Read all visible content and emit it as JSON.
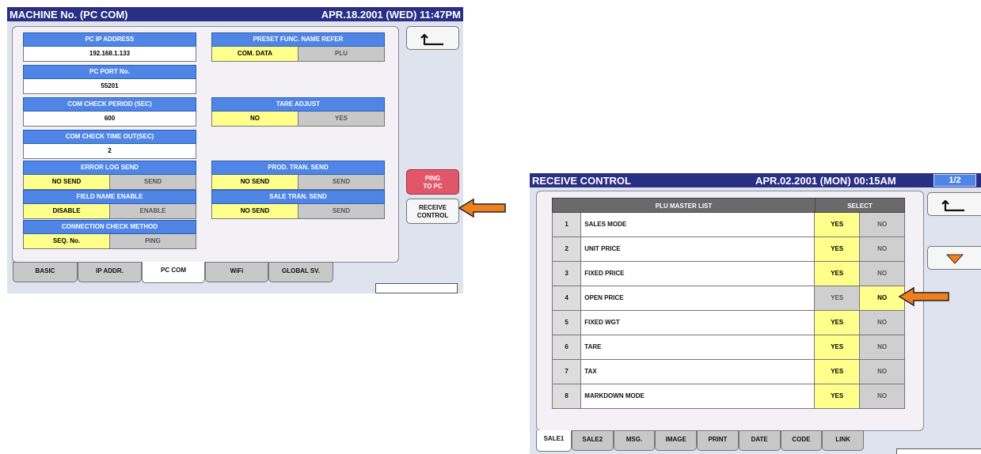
{
  "left_screen": {
    "title": "MACHINE No. (PC COM)",
    "datetime": "APR.18.2001 (WED)  11:47PM",
    "fields": {
      "pc_ip_address": {
        "label": "PC IP ADDRESS",
        "value": "192.168.1.133"
      },
      "pc_port": {
        "label": "PC PORT No.",
        "value": "55201"
      },
      "com_check_period": {
        "label": "COM CHECK PERIOD (SEC)",
        "value": "600"
      },
      "com_check_timeout": {
        "label": "COM CHECK TIME OUT(SEC)",
        "value": "2"
      }
    },
    "toggles": {
      "preset_func": {
        "label": "PRESET FUNC. NAME REFER",
        "left": "COM. DATA",
        "right": "PLU",
        "selected": "left"
      },
      "tare_adjust": {
        "label": "TARE ADJUST",
        "left": "NO",
        "right": "YES",
        "selected": "left"
      },
      "error_log_send": {
        "label": "ERROR LOG SEND",
        "left": "NO SEND",
        "right": "SEND",
        "selected": "left"
      },
      "prod_tran_send": {
        "label": "PROD. TRAN. SEND",
        "left": "NO SEND",
        "right": "SEND",
        "selected": "left"
      },
      "field_name_enable": {
        "label": "FIELD NAME ENABLE",
        "left": "DISABLE",
        "right": "ENABLE",
        "selected": "left"
      },
      "sale_tran_send": {
        "label": "SALE TRAN. SEND",
        "left": "NO SEND",
        "right": "SEND",
        "selected": "left"
      },
      "connection_check": {
        "label": "CONNECTION CHECK METHOD",
        "left": "SEQ. No.",
        "right": "PING",
        "selected": "left"
      }
    },
    "buttons": {
      "ping_line1": "PING",
      "ping_line2": "TO PC",
      "receive_line1": "RECEIVE",
      "receive_line2": "CONTROL"
    },
    "tabs": [
      "BASIC",
      "IP ADDR.",
      "PC COM",
      "WiFi",
      "GLOBAL SV."
    ],
    "active_tab": "PC COM"
  },
  "right_screen": {
    "title": "RECEIVE CONTROL",
    "datetime": "APR.02.2001 (MON)  00:15AM",
    "page": "1/2",
    "list_header": "PLU MASTER LIST",
    "select_header": "SELECT",
    "rows": [
      {
        "num": "1",
        "label": "SALES MODE",
        "yes": "YES",
        "no": "NO",
        "selected": "yes"
      },
      {
        "num": "2",
        "label": "UNIT PRICE",
        "yes": "YES",
        "no": "NO",
        "selected": "yes"
      },
      {
        "num": "3",
        "label": "FIXED PRICE",
        "yes": "YES",
        "no": "NO",
        "selected": "yes"
      },
      {
        "num": "4",
        "label": "OPEN PRICE",
        "yes": "YES",
        "no": "NO",
        "selected": "no"
      },
      {
        "num": "5",
        "label": "FIXED WGT",
        "yes": "YES",
        "no": "NO",
        "selected": "yes"
      },
      {
        "num": "6",
        "label": "TARE",
        "yes": "YES",
        "no": "NO",
        "selected": "yes"
      },
      {
        "num": "7",
        "label": "TAX",
        "yes": "YES",
        "no": "NO",
        "selected": "yes"
      },
      {
        "num": "8",
        "label": "MARKDOWN MODE",
        "yes": "YES",
        "no": "NO",
        "selected": "yes"
      }
    ],
    "tabs": [
      "SALE1",
      "SALE2",
      "MSG.",
      "IMAGE",
      "PRINT",
      "DATE",
      "CODE",
      "LINK"
    ],
    "active_tab": "SALE1"
  },
  "colors": {
    "title_bar": "#2a2f86",
    "header_blue": "#4f86e6",
    "selected_yellow": "#ffff8c",
    "unselected_gray": "#c8c8c8",
    "ping_red": "#e2566a",
    "arrow_orange": "#f07f1e"
  },
  "icons": {
    "back": "return-arrow-icon",
    "down": "down-triangle-icon",
    "pointer": "orange-arrow-icon"
  }
}
